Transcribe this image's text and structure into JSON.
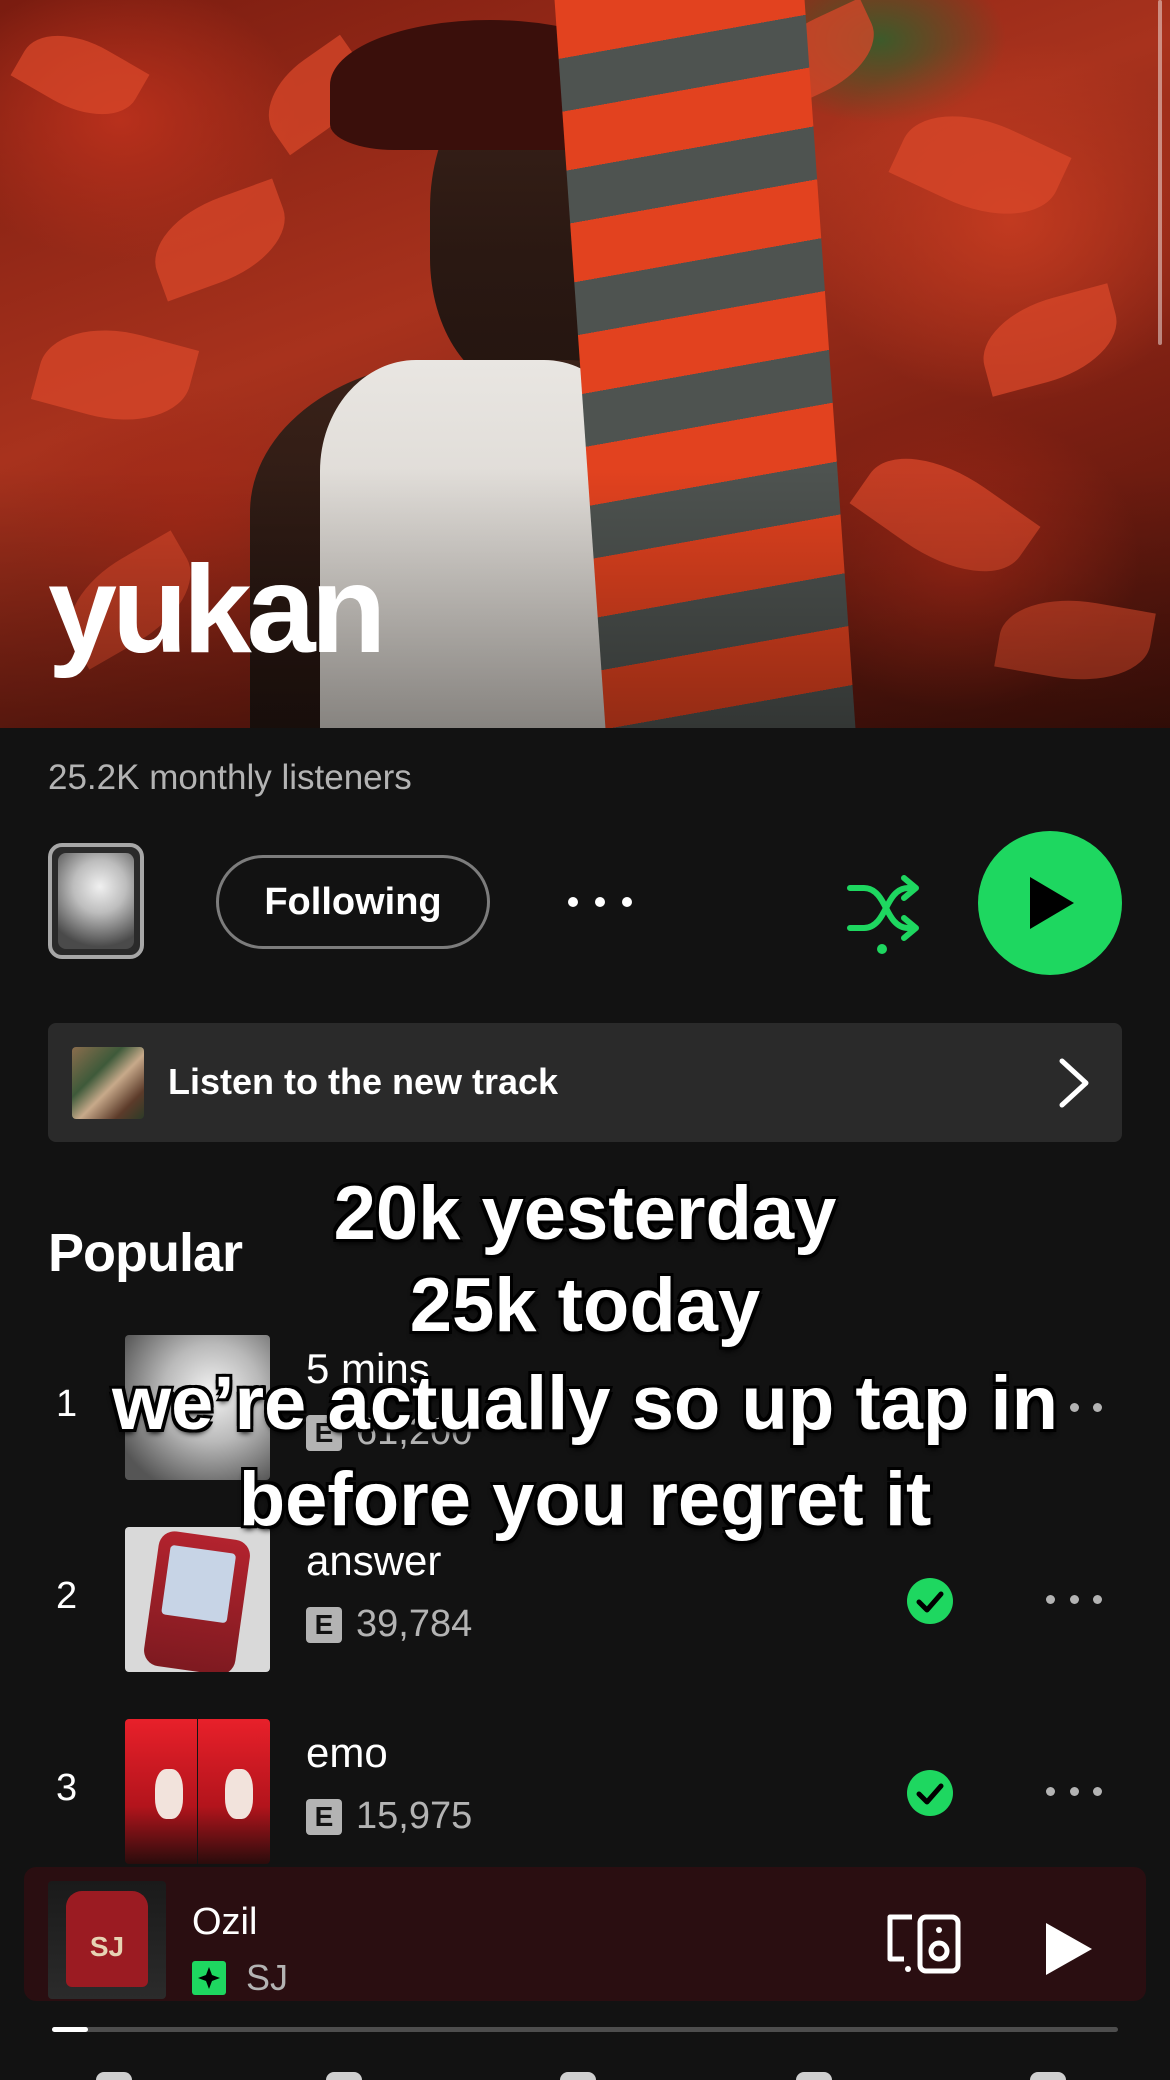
{
  "artist": {
    "name": "yukan",
    "monthly_listeners": "25.2K monthly listeners"
  },
  "actions": {
    "follow_label": "Following"
  },
  "banner": {
    "label": "Listen to the new track"
  },
  "popular": {
    "heading": "Popular",
    "tracks": [
      {
        "rank": "1",
        "title": "5 mins",
        "explicit": "E",
        "plays": "61,200",
        "downloaded": false
      },
      {
        "rank": "2",
        "title": "answer",
        "explicit": "E",
        "plays": "39,784",
        "downloaded": true
      },
      {
        "rank": "3",
        "title": "emo",
        "explicit": "E",
        "plays": "15,975",
        "downloaded": true
      }
    ]
  },
  "caption": {
    "lines": [
      "20k yesterday",
      "25k today",
      "we’re actually so up tap in",
      "before you regret it"
    ]
  },
  "now_playing": {
    "title": "Ozil",
    "artist": "SJ",
    "progress": 0.034
  },
  "colors": {
    "accent": "#1ed760",
    "background": "#121212",
    "banner": "#2a2a2a",
    "now_playing_bg": "#2a0e11"
  }
}
